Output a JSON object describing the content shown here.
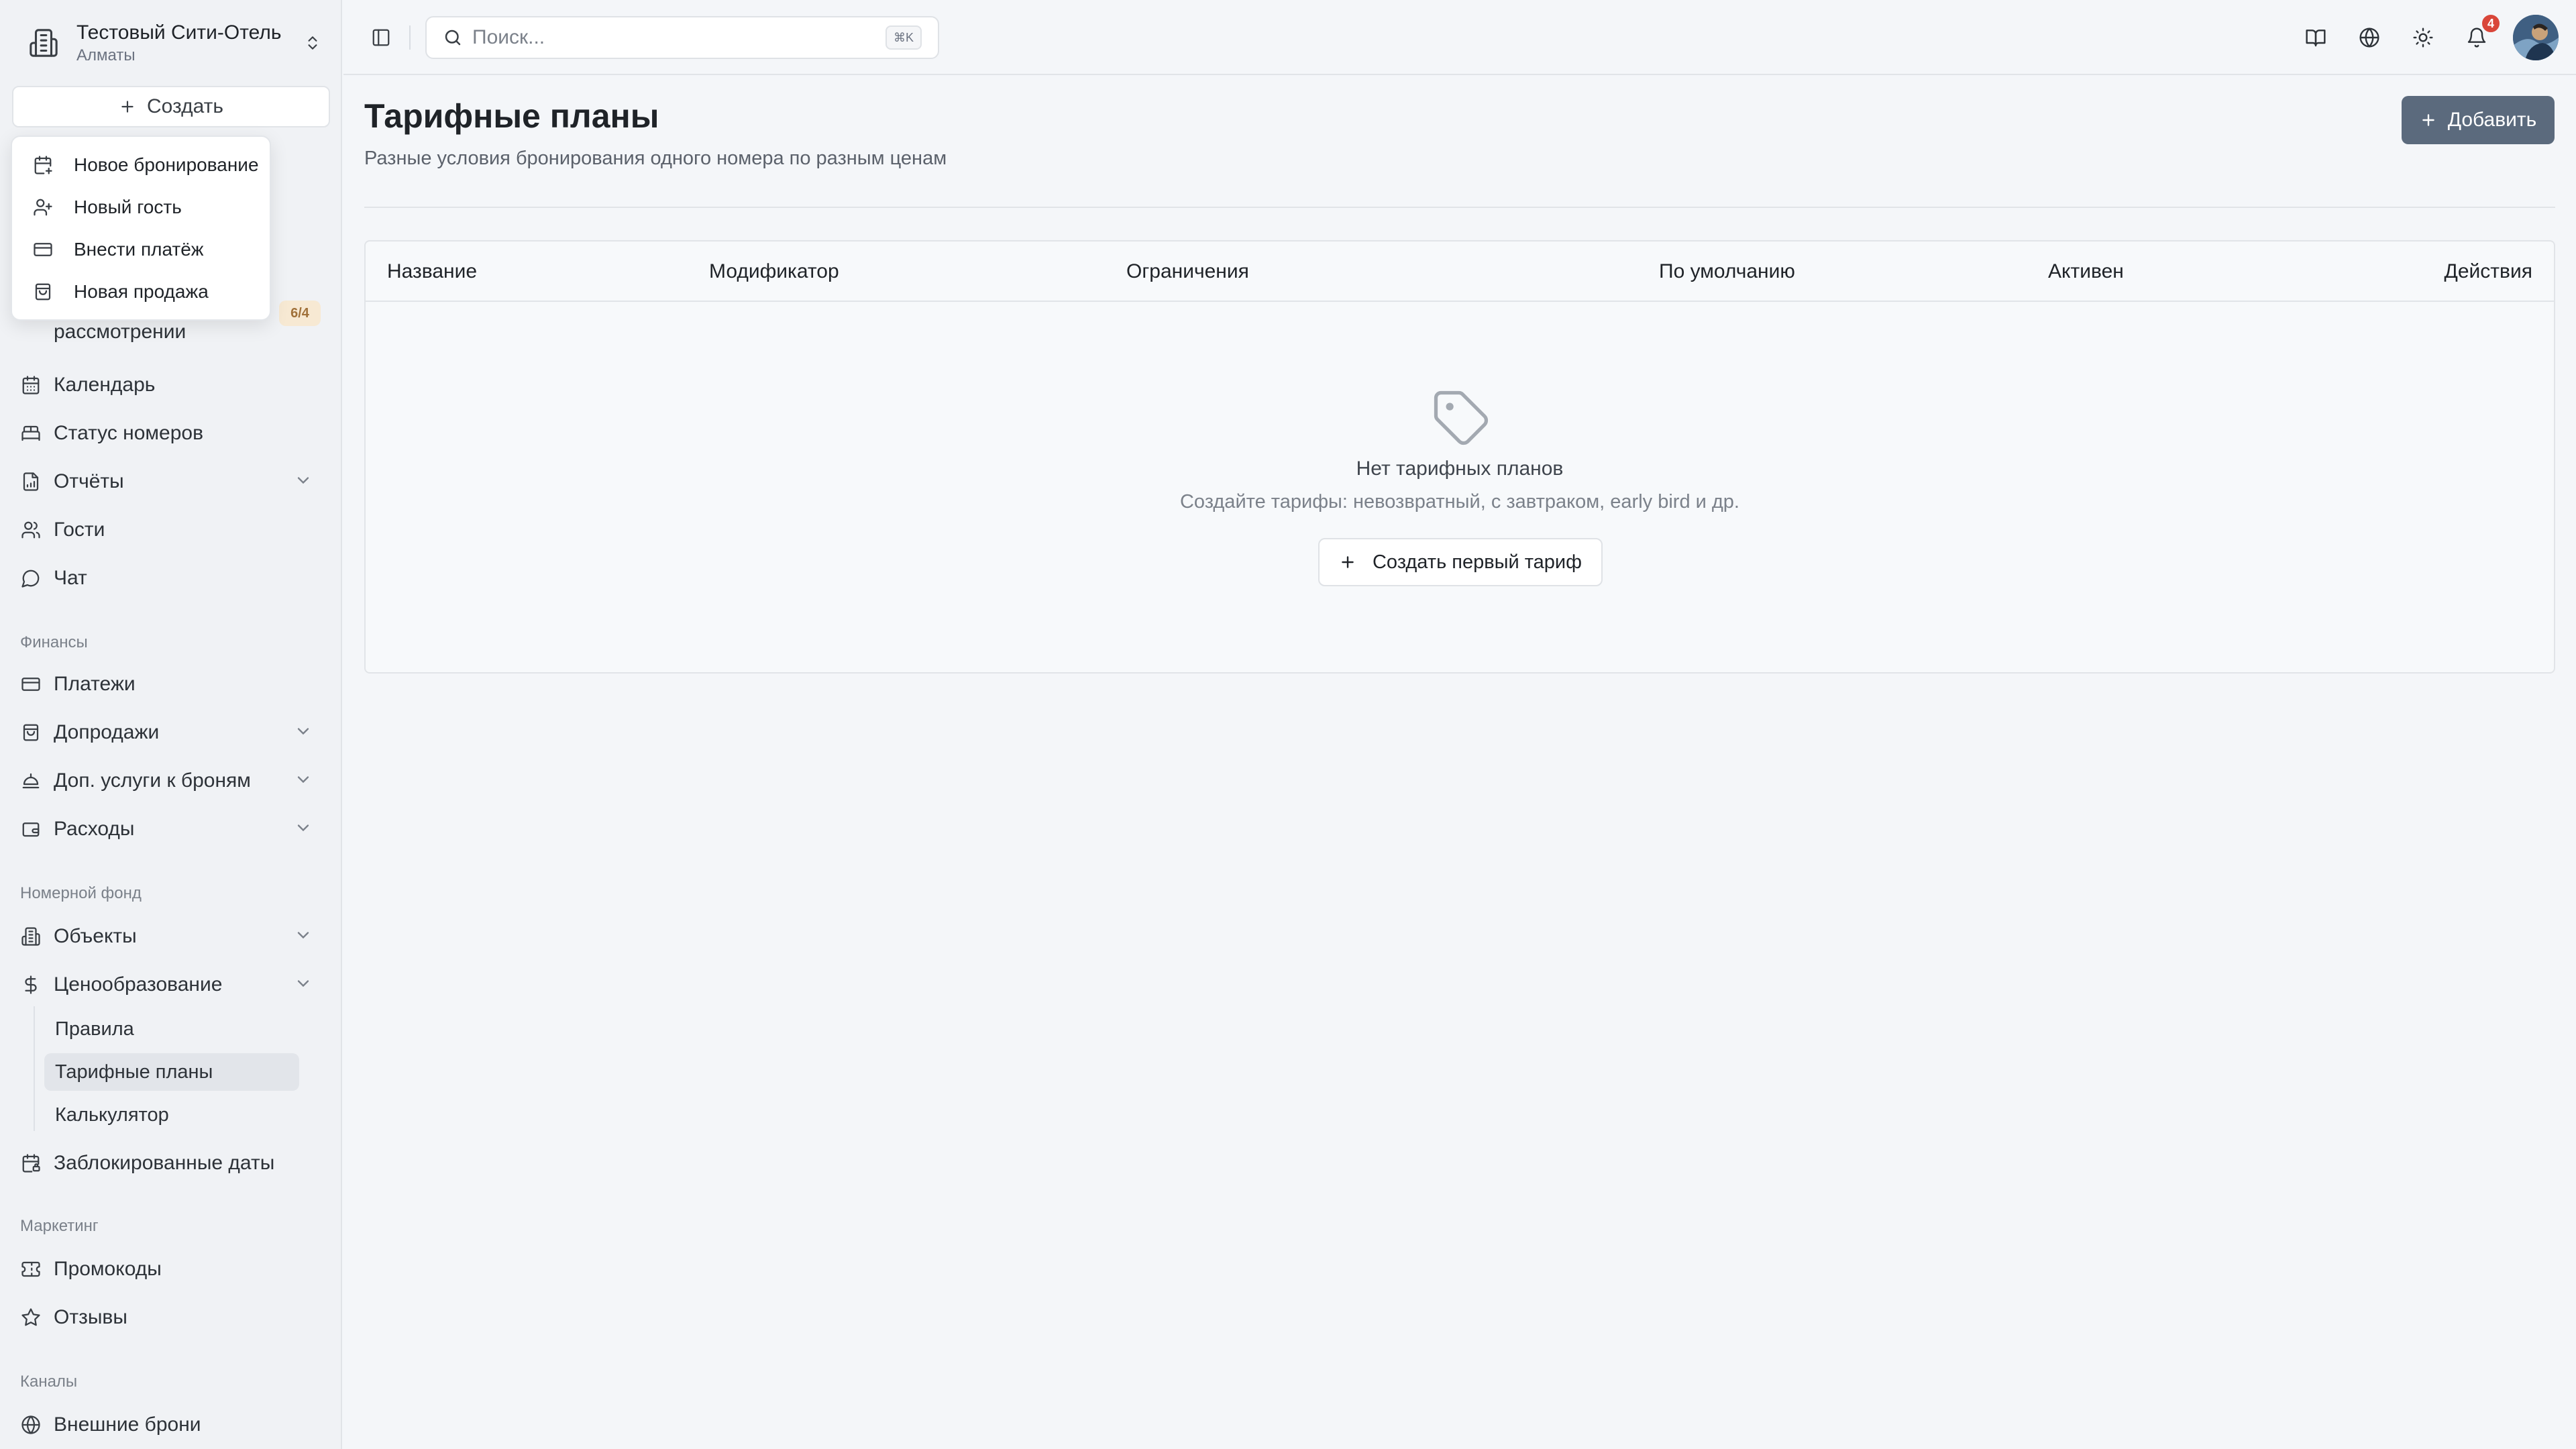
{
  "hotel": {
    "name": "Тестовый Сити-Отель",
    "city": "Алматы"
  },
  "sidebar": {
    "create_label": "Создать",
    "partial_item_label": "рассмотрении",
    "partial_item_badge": "6/4",
    "items_top": [
      {
        "label": "Календарь",
        "icon": "calendar-icon"
      },
      {
        "label": "Статус номеров",
        "icon": "bed-icon"
      },
      {
        "label": "Отчёты",
        "icon": "report-icon",
        "expandable": true
      },
      {
        "label": "Гости",
        "icon": "users-icon"
      },
      {
        "label": "Чат",
        "icon": "chat-icon"
      }
    ],
    "section_finance": "Финансы",
    "items_finance": [
      {
        "label": "Платежи",
        "icon": "credit-card-icon"
      },
      {
        "label": "Допродажи",
        "icon": "shopping-bag-icon",
        "expandable": true
      },
      {
        "label": "Доп. услуги к броням",
        "icon": "service-bell-icon",
        "expandable": true
      },
      {
        "label": "Расходы",
        "icon": "wallet-icon",
        "expandable": true
      }
    ],
    "section_rooms": "Номерной фонд",
    "items_rooms": [
      {
        "label": "Объекты",
        "icon": "building-icon",
        "expandable": true
      },
      {
        "label": "Ценообразование",
        "icon": "dollar-icon",
        "expandable": true
      }
    ],
    "pricing_sub": [
      {
        "label": "Правила",
        "active": false
      },
      {
        "label": "Тарифные планы",
        "active": true
      },
      {
        "label": "Калькулятор",
        "active": false
      }
    ],
    "blocked_dates": "Заблокированные даты",
    "section_marketing": "Маркетинг",
    "items_marketing": [
      {
        "label": "Промокоды",
        "icon": "ticket-icon"
      },
      {
        "label": "Отзывы",
        "icon": "star-icon"
      }
    ],
    "section_channels": "Каналы",
    "items_channels": [
      {
        "label": "Внешние брони",
        "icon": "globe-icon"
      }
    ]
  },
  "create_menu": [
    {
      "label": "Новое бронирование",
      "icon": "calendar-plus-icon"
    },
    {
      "label": "Новый гость",
      "icon": "user-plus-icon"
    },
    {
      "label": "Внести платёж",
      "icon": "credit-card-icon"
    },
    {
      "label": "Новая продажа",
      "icon": "shopping-bag-icon"
    }
  ],
  "topbar": {
    "search_placeholder": "Поиск...",
    "search_shortcut": "⌘K",
    "notifications_count": "4"
  },
  "main": {
    "title": "Тарифные планы",
    "subtitle": "Разные условия бронирования одного номера по разным ценам",
    "add_label": "Добавить",
    "columns": [
      "Название",
      "Модификатор",
      "Ограничения",
      "По умолчанию",
      "Активен",
      "Действия"
    ],
    "empty_title": "Нет тарифных планов",
    "empty_desc": "Создайте тарифы: невозвратный, с завтраком, early bird и др.",
    "empty_button": "Создать первый тариф"
  },
  "colors": {
    "accent_button": "#5b6a7d",
    "notification_badge": "#d9463a",
    "warning_badge_bg": "#f7e9d3"
  }
}
